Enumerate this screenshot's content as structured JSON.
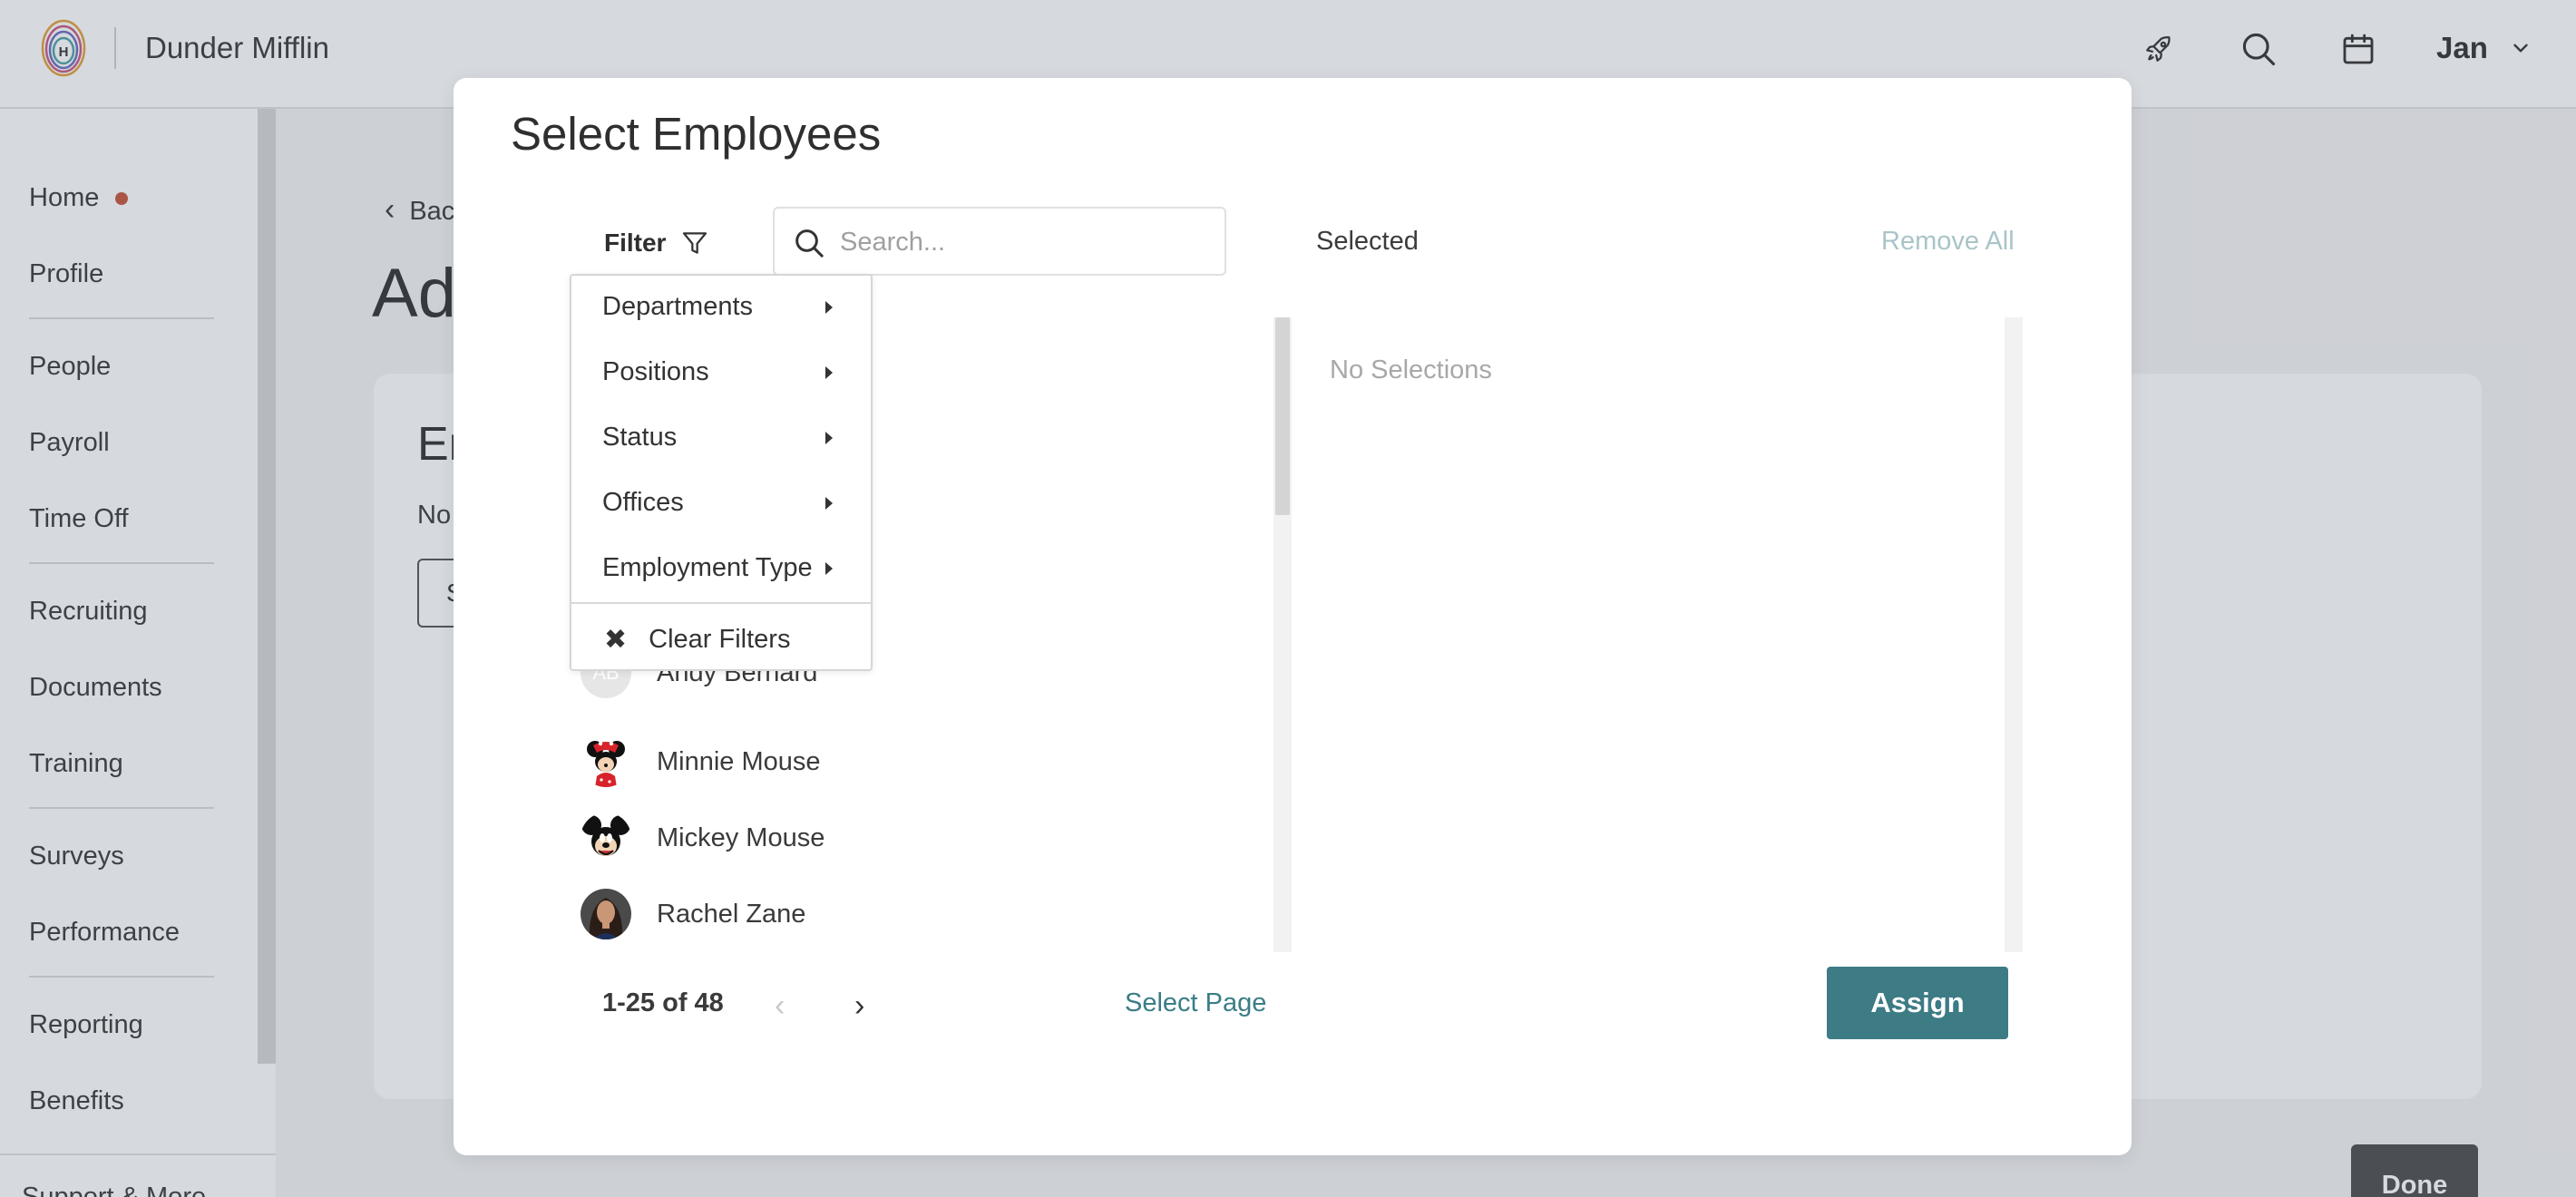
{
  "header": {
    "company": "Dunder Mifflin",
    "user": "Jan",
    "logo_letter": "H",
    "icons": [
      "rocket-icon",
      "search-icon",
      "calendar-icon",
      "chevron-down-icon"
    ]
  },
  "sidebar": {
    "items": [
      {
        "label": "Home"
      },
      {
        "label": "Profile"
      },
      {
        "label": "People"
      },
      {
        "label": "Payroll"
      },
      {
        "label": "Time Off"
      },
      {
        "label": "Recruiting"
      },
      {
        "label": "Documents"
      },
      {
        "label": "Training"
      },
      {
        "label": "Surveys"
      },
      {
        "label": "Performance"
      },
      {
        "label": "Reporting"
      },
      {
        "label": "Benefits"
      }
    ],
    "bottom_label": "Support & More",
    "home_dot_color": "#c7573e"
  },
  "background": {
    "back_label": "Back",
    "page_title": "Ad",
    "card_title": "En",
    "card_text": "No",
    "card_button": "S",
    "done_label": "Done"
  },
  "modal": {
    "title": "Select Employees",
    "filter_label": "Filter",
    "search_placeholder": "Search...",
    "selected_label": "Selected",
    "remove_all_label": "Remove All",
    "no_selections": "No Selections",
    "filter_menu": {
      "items": [
        {
          "label": "Departments"
        },
        {
          "label": "Positions"
        },
        {
          "label": "Status"
        },
        {
          "label": "Offices"
        },
        {
          "label": "Employment Type"
        }
      ],
      "clear_label": "Clear Filters"
    },
    "employees": [
      {
        "name": "Andy Bernard",
        "initials": "AB"
      },
      {
        "name": "Minnie Mouse"
      },
      {
        "name": "Mickey Mouse"
      },
      {
        "name": "Rachel Zane"
      }
    ],
    "pagination": {
      "range_text": "1-25 of 48",
      "prev": "‹",
      "next": "›"
    },
    "select_page_label": "Select Page",
    "assign_label": "Assign",
    "accent_color": "#3d7b85"
  }
}
